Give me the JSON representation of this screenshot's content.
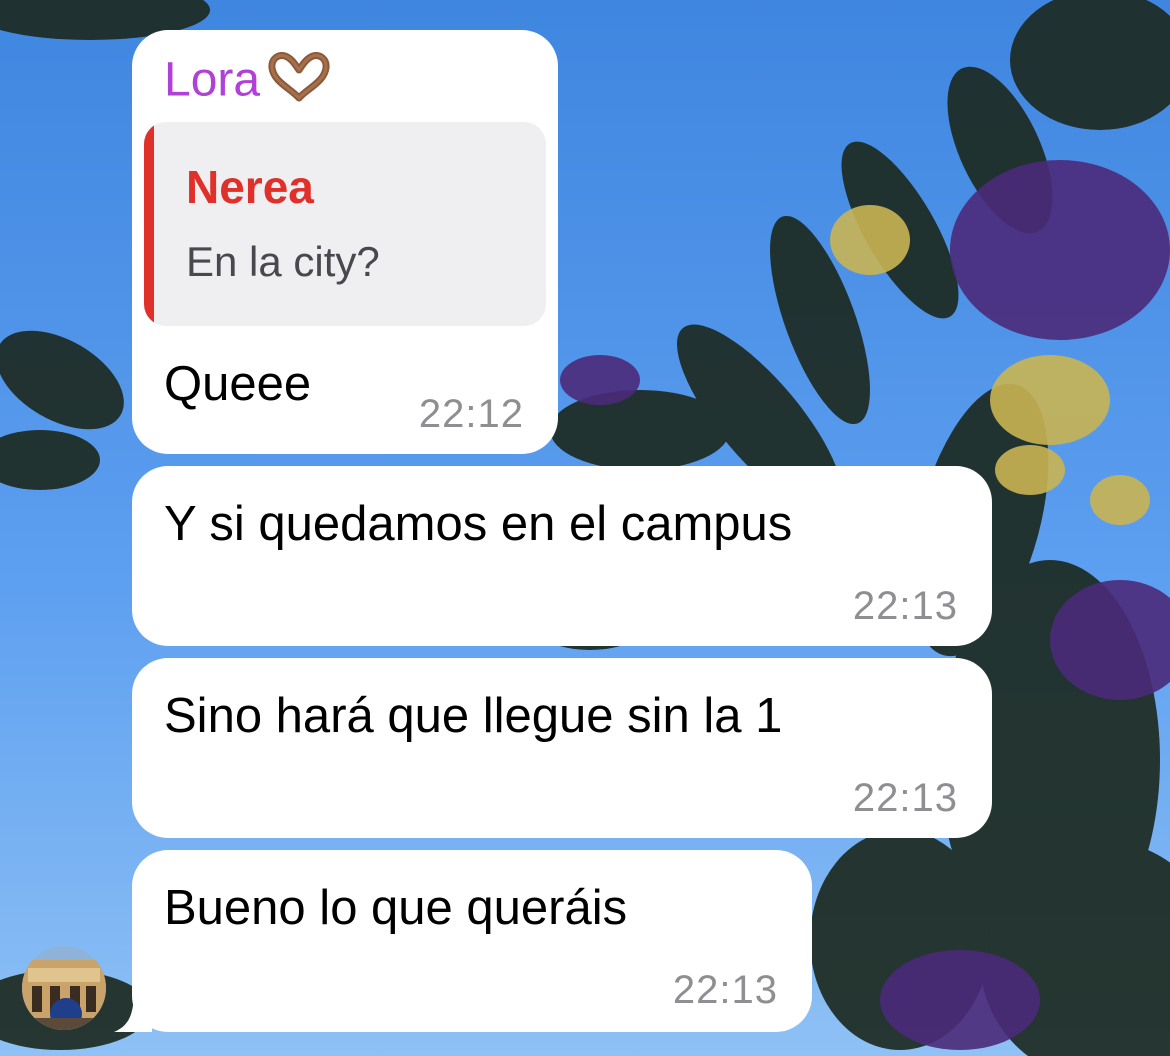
{
  "chat": {
    "messages": [
      {
        "sender": "Lora",
        "sender_emoji": "heart-hands-emoji",
        "reply": {
          "author": "Nerea",
          "text": "En la city?"
        },
        "text": "Queee",
        "time": "22:12"
      },
      {
        "text": "Y si quedamos en el campus",
        "time": "22:13"
      },
      {
        "text": "Sino hará que llegue sin la 1",
        "time": "22:13"
      },
      {
        "text": "Bueno lo que queráis",
        "time": "22:13"
      }
    ]
  },
  "colors": {
    "sender_name": "#b040d8",
    "reply_accent": "#e0302a",
    "bubble": "#ffffff",
    "timestamp": "#8e8e93"
  }
}
